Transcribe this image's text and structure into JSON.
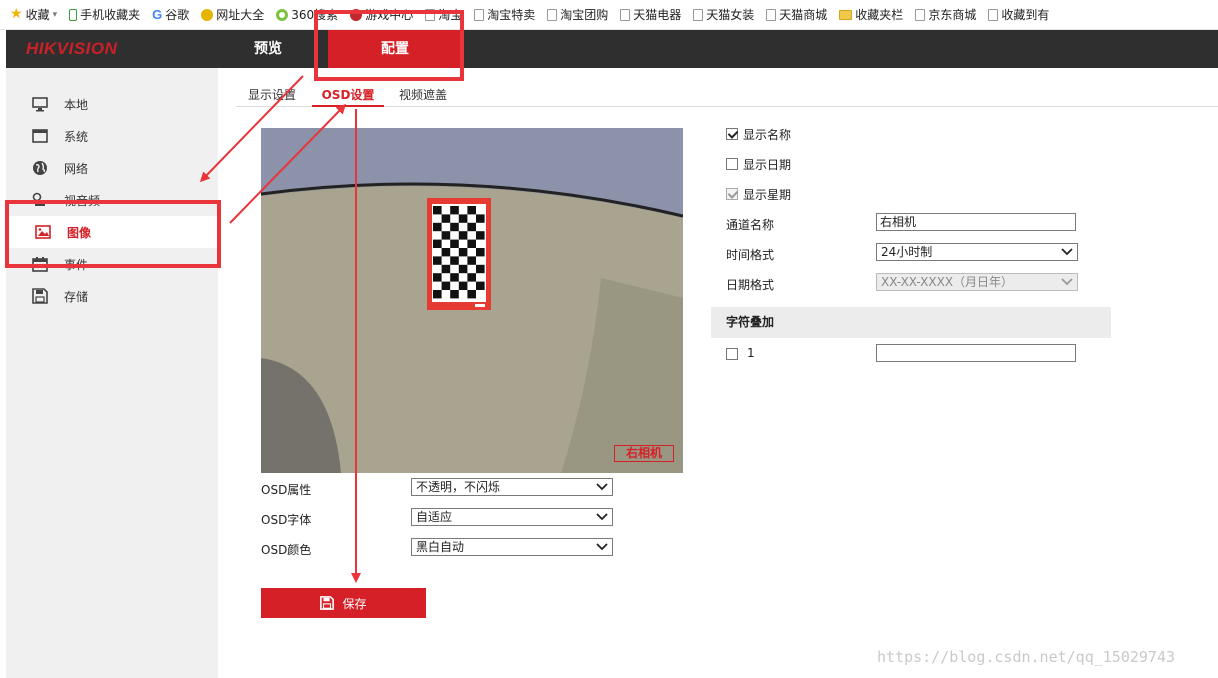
{
  "bookmarks": [
    {
      "label": "收藏",
      "icon": "star-icon"
    },
    {
      "label": "手机收藏夹",
      "icon": "phone-icon"
    },
    {
      "label": "谷歌",
      "icon": "google-icon"
    },
    {
      "label": "网址大全",
      "icon": "nav-site-icon"
    },
    {
      "label": "360搜索",
      "icon": "search-engine-icon"
    },
    {
      "label": "游戏中心",
      "icon": "game-icon"
    },
    {
      "label": "淘宝",
      "icon": "page-icon"
    },
    {
      "label": "淘宝特卖",
      "icon": "page-icon"
    },
    {
      "label": "淘宝团购",
      "icon": "page-icon"
    },
    {
      "label": "天猫电器",
      "icon": "page-icon"
    },
    {
      "label": "天猫女装",
      "icon": "page-icon"
    },
    {
      "label": "天猫商城",
      "icon": "page-icon"
    },
    {
      "label": "收藏夹栏",
      "icon": "folder-icon"
    },
    {
      "label": "京东商城",
      "icon": "page-icon"
    },
    {
      "label": "收藏到有",
      "icon": "page-icon"
    }
  ],
  "header": {
    "logo": "HIKVISION",
    "tabs": [
      {
        "label": "预览",
        "active": false
      },
      {
        "label": "配置",
        "active": true
      }
    ]
  },
  "sidebar": {
    "items": [
      {
        "label": "本地",
        "icon": "monitor-icon",
        "active": false
      },
      {
        "label": "系统",
        "icon": "system-icon",
        "active": false
      },
      {
        "label": "网络",
        "icon": "globe-icon",
        "active": false
      },
      {
        "label": "视音频",
        "icon": "audio-video-icon",
        "active": false
      },
      {
        "label": "图像",
        "icon": "image-icon",
        "active": true
      },
      {
        "label": "事件",
        "icon": "calendar-icon",
        "active": false
      },
      {
        "label": "存储",
        "icon": "storage-icon",
        "active": false
      }
    ]
  },
  "subtabs": [
    {
      "label": "显示设置",
      "active": false
    },
    {
      "label": "OSD设置",
      "active": true
    },
    {
      "label": "视频遮盖",
      "active": false
    }
  ],
  "video": {
    "osd_overlay_text": "右相机"
  },
  "osd_options": {
    "attribute": {
      "label": "OSD属性",
      "value": "不透明，不闪烁"
    },
    "font": {
      "label": "OSD字体",
      "value": "自适应"
    },
    "color": {
      "label": "OSD颜色",
      "value": "黑白自动"
    }
  },
  "save_button": {
    "label": "保存",
    "icon": "floppy-icon"
  },
  "display_options": {
    "show_name": {
      "label": "显示名称",
      "checked": true
    },
    "show_date": {
      "label": "显示日期",
      "checked": false
    },
    "show_week": {
      "label": "显示星期",
      "checked": true,
      "disabled": true
    }
  },
  "fields": {
    "channel_name": {
      "label": "通道名称",
      "value": "右相机"
    },
    "time_format": {
      "label": "时间格式",
      "value": "24小时制"
    },
    "date_format": {
      "label": "日期格式",
      "value": "XX-XX-XXXX（月日年）"
    }
  },
  "overlay_section": {
    "title": "字符叠加",
    "rows": [
      {
        "index": "1",
        "checked": false,
        "value": ""
      }
    ]
  },
  "annotation": {
    "color": "#e8343a"
  },
  "colors": {
    "brand_red": "#d62027",
    "topbar": "#2f2f2f",
    "sidebar_bg": "#f0f0f0"
  },
  "watermark": "https://blog.csdn.net/qq_15029743"
}
